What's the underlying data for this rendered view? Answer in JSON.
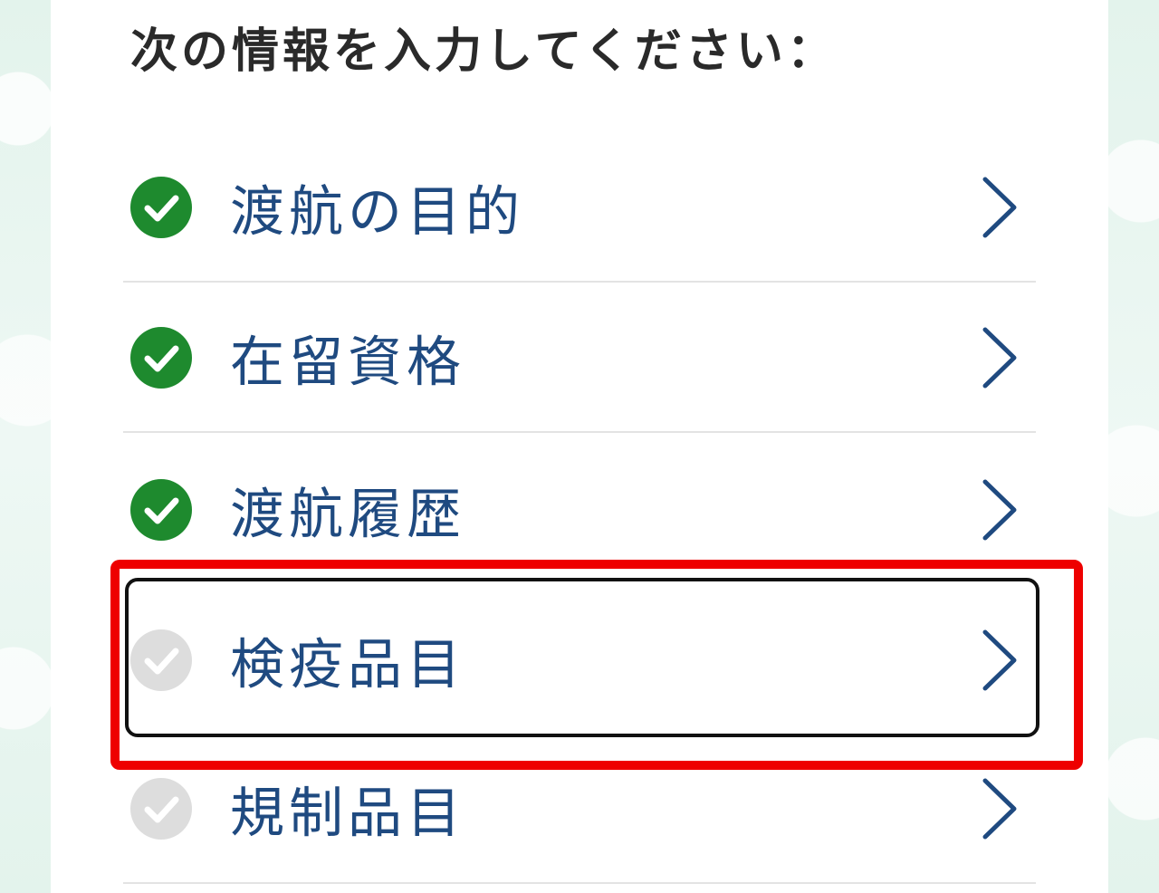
{
  "heading": "次の情報を入力してください：",
  "items": [
    {
      "label": "渡航の目的",
      "completed": true
    },
    {
      "label": "在留資格",
      "completed": true
    },
    {
      "label": "渡航履歴",
      "completed": true
    },
    {
      "label": "検疫品目",
      "completed": false
    },
    {
      "label": "規制品目",
      "completed": false
    }
  ],
  "colors": {
    "completed": "#1e8a2e",
    "pending": "#dddddd",
    "label": "#1f4a80",
    "highlight": "#ee0000"
  },
  "icons": {
    "status": "check-circle-icon",
    "arrow": "chevron-right-icon"
  }
}
